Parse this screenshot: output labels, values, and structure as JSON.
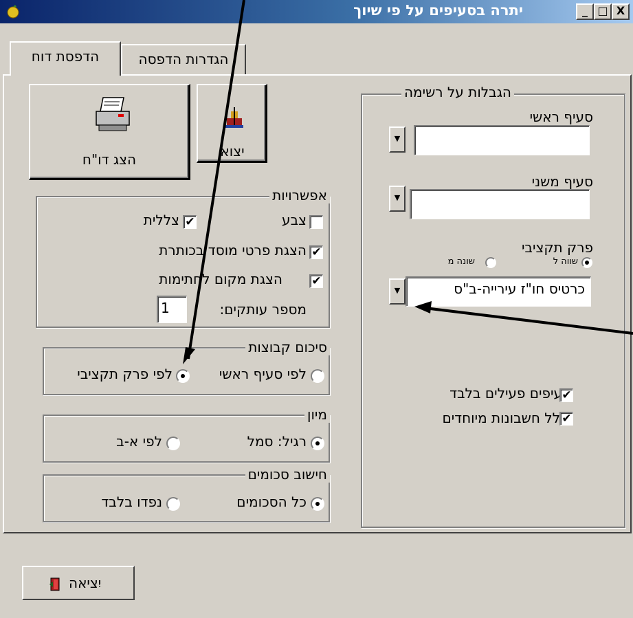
{
  "window": {
    "title": "יתרה בסעיפים על פי שיוך",
    "minimize": "_",
    "maximize": "□",
    "close": "X"
  },
  "tabs": [
    "הדפסת דוח",
    "הגדרות הדפסה"
  ],
  "buttons": {
    "show_report": "הצג דו\"ח",
    "exit_top": "יצוא",
    "exit_bottom": "יִציאה"
  },
  "options": {
    "title": "אפשרויות",
    "color": "צבע",
    "shading": "צללית",
    "show_org_in_header": "הצגת פרטי מוסד בכותרת",
    "show_signature_space": "הצגת מקום לחתימות",
    "copies_label": "מספר עותקים:",
    "copies_value": "1"
  },
  "group_summary": {
    "title": "סיכום קבוצות",
    "by_main": "לפי סעיף ראשי",
    "by_budget": "לפי פרק תקציבי",
    "selected": "by_budget"
  },
  "sort": {
    "title": "מיון",
    "regular": "רגיל: סמל",
    "alpha": "לפי א-ב",
    "selected": "regular"
  },
  "amounts": {
    "title": "חישוב סכומים",
    "all": "כל הסכומים",
    "only_paid": "נפדו בלבד",
    "selected": "all"
  },
  "filters": {
    "title": "הגבלות על רשימה",
    "main_item_label": "סעיף ראשי",
    "main_item_value": "",
    "sub_item_label": "סעיף משני",
    "sub_item_value": "",
    "budget_label": "פרק תקציבי",
    "equal_to": "שווה ל",
    "not_equal": "שונה מ",
    "budget_value": "כרטיס חו\"ז עירייה-ב\"ס",
    "active_only": "סעיפים פעילים בלבד",
    "include_special": "כולל חשבונות מיוחדים"
  },
  "colors": {
    "titlebar_start": "#0a246a",
    "titlebar_end": "#a6caf0",
    "face": "#d4d0c8"
  }
}
